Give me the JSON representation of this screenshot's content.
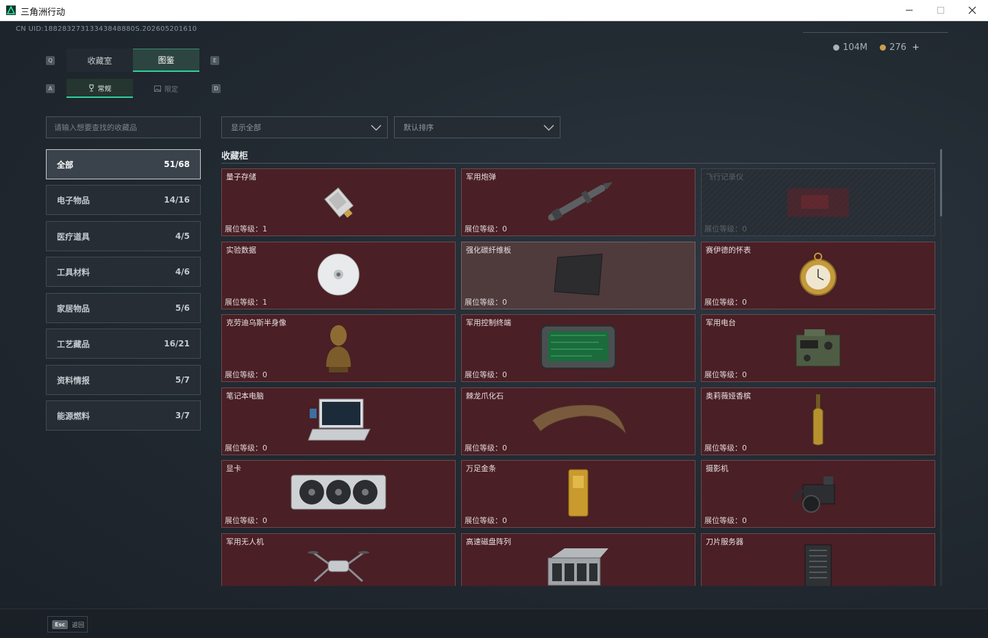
{
  "window": {
    "title": "三角洲行动",
    "app_icon": "delta-force-logo-icon"
  },
  "uid": "CN UID:18828327313343848880S.202605201610",
  "currency": {
    "silver": "104M",
    "gold": "276",
    "plus": "+"
  },
  "keys": {
    "q": "Q",
    "e": "E",
    "a": "A",
    "d": "D"
  },
  "tabs": [
    {
      "label": "收藏室",
      "active": false
    },
    {
      "label": "图鉴",
      "active": true
    }
  ],
  "subtabs": [
    {
      "label": "常规",
      "icon": "trophy-icon",
      "active": true
    },
    {
      "label": "限定",
      "icon": "image-frame-icon",
      "active": false
    }
  ],
  "search": {
    "placeholder": "请输入想要查找的收藏品"
  },
  "filters": {
    "display": "显示全部",
    "sort": "默认排序"
  },
  "categories": [
    {
      "label": "全部",
      "count": "51/68",
      "active": true
    },
    {
      "label": "电子物品",
      "count": "14/16"
    },
    {
      "label": "医疗道具",
      "count": "4/5"
    },
    {
      "label": "工具材料",
      "count": "4/6"
    },
    {
      "label": "家居物品",
      "count": "5/6"
    },
    {
      "label": "工艺藏品",
      "count": "16/21"
    },
    {
      "label": "资料情报",
      "count": "5/7"
    },
    {
      "label": "能源燃料",
      "count": "3/7"
    }
  ],
  "section_title": "收藏柜",
  "level_prefix": "展位等级：",
  "items": [
    {
      "name": "量子存储",
      "level": "1",
      "icon": "quantum-storage-icon"
    },
    {
      "name": "军用炮弹",
      "level": "0",
      "icon": "artillery-shell-icon"
    },
    {
      "name": "飞行记录仪",
      "level": "0",
      "icon": "flight-recorder-icon",
      "locked": true
    },
    {
      "name": "实验数据",
      "level": "1",
      "icon": "disc-icon"
    },
    {
      "name": "强化碳纤维板",
      "level": "0",
      "icon": "carbon-plate-icon",
      "light": true
    },
    {
      "name": "赛伊德的怀表",
      "level": "0",
      "icon": "pocket-watch-icon"
    },
    {
      "name": "克劳迪乌斯半身像",
      "level": "0",
      "icon": "bust-icon"
    },
    {
      "name": "军用控制终端",
      "level": "0",
      "icon": "control-terminal-icon"
    },
    {
      "name": "军用电台",
      "level": "0",
      "icon": "military-radio-icon"
    },
    {
      "name": "笔记本电脑",
      "level": "0",
      "icon": "laptop-icon"
    },
    {
      "name": "棘龙爪化石",
      "level": "0",
      "icon": "claw-fossil-icon"
    },
    {
      "name": "奥莉薇娅香槟",
      "level": "0",
      "icon": "champagne-icon"
    },
    {
      "name": "显卡",
      "level": "0",
      "icon": "graphics-card-icon"
    },
    {
      "name": "万足金条",
      "level": "0",
      "icon": "gold-bar-icon"
    },
    {
      "name": "摄影机",
      "level": "0",
      "icon": "camera-icon"
    },
    {
      "name": "军用无人机",
      "level": "",
      "icon": "drone-icon"
    },
    {
      "name": "高速磁盘阵列",
      "level": "",
      "icon": "disk-array-icon"
    },
    {
      "name": "刀片服务器",
      "level": "",
      "icon": "blade-server-icon"
    }
  ],
  "footer": {
    "esc_key": "Esc",
    "back_label": "返回"
  },
  "colors": {
    "accent": "#2fd3a0",
    "card_bg": "#4a1f25",
    "card_border": "#6d4b4f"
  }
}
